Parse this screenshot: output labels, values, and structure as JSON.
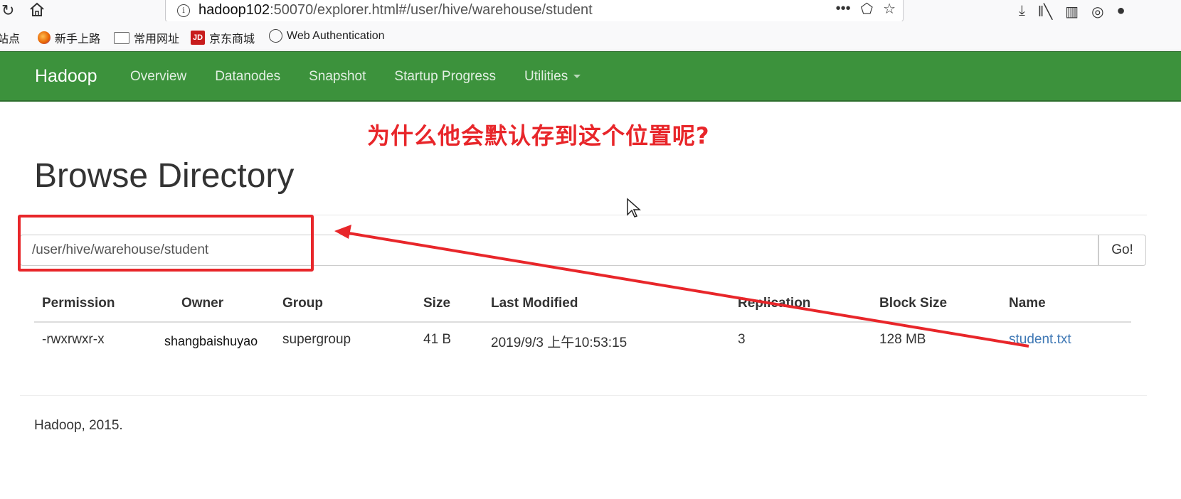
{
  "browser": {
    "url_host": "hadoop102",
    "url_rest": ":50070/explorer.html#/user/hive/warehouse/student",
    "bookmarks": [
      "站点",
      "新手上路",
      "常用网址",
      "京东商城",
      "Web Authentication"
    ]
  },
  "navbar": {
    "brand": "Hadoop",
    "items": [
      "Overview",
      "Datanodes",
      "Snapshot",
      "Startup Progress",
      "Utilities"
    ]
  },
  "annotation": "为什么他会默认存到这个位置呢?",
  "page": {
    "title": "Browse Directory",
    "path_value": "/user/hive/warehouse/student",
    "go_label": "Go!"
  },
  "table": {
    "headers": [
      "Permission",
      "Owner",
      "Group",
      "Size",
      "Last Modified",
      "Replication",
      "Block Size",
      "Name"
    ],
    "rows": [
      [
        "-rwxrwxr-x",
        "shangbaishuyao",
        "supergroup",
        "41 B",
        "2019/9/3 上午10:53:15",
        "3",
        "128 MB",
        "student.txt"
      ]
    ]
  },
  "footer": "Hadoop, 2015.",
  "colors": {
    "navbar": "#3c923c",
    "annotation": "#e8262a",
    "link": "#3f78b5"
  }
}
